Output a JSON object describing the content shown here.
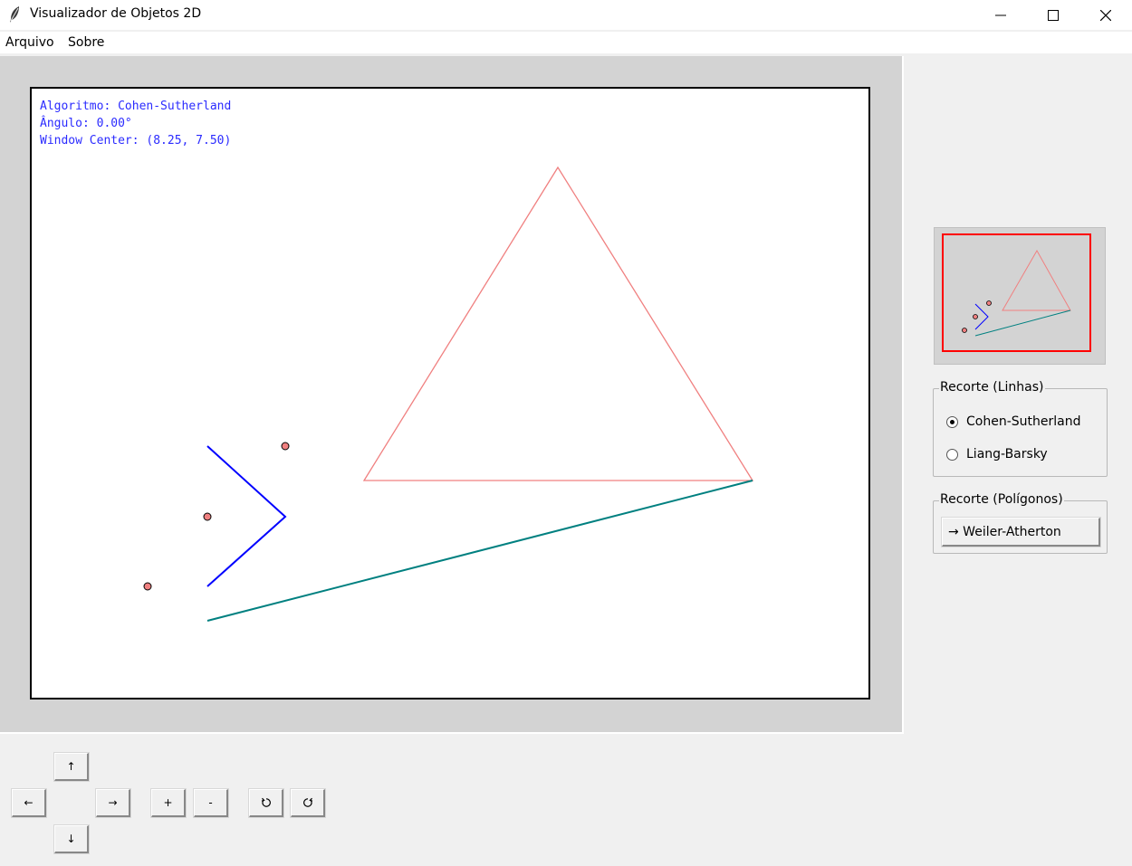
{
  "window": {
    "title": "Visualizador de Objetos 2D",
    "app_icon": "feather-icon",
    "controls": [
      "minimize-icon",
      "maximize-icon",
      "close-icon"
    ]
  },
  "menu": {
    "items": [
      "Arquivo",
      "Sobre"
    ]
  },
  "viewport": {
    "info_lines": [
      "Algoritmo: Cohen-Sutherland",
      "Ângulo: 0.00°",
      "Window Center: (8.25, 7.50)"
    ],
    "colors": {
      "info_text": "#2b2bff",
      "triangle": "#f08080",
      "polyline": "#0000ff",
      "line": "#008080",
      "point_fill": "#f08080",
      "minimap_frame": "#ff0000"
    }
  },
  "clipping_lines": {
    "title": "Recorte (Linhas)",
    "options": [
      "Cohen-Sutherland",
      "Liang-Barsky"
    ],
    "selected": "Cohen-Sutherland"
  },
  "clipping_polygons": {
    "title": "Recorte (Polígonos)",
    "button_label": "→ Weiler-Atherton"
  },
  "controls": {
    "up": "↑",
    "left": "←",
    "right": "→",
    "down": "↓",
    "zoom_in": "+",
    "zoom_out": "-",
    "rotate_left_icon": "rotate-ccw-icon",
    "rotate_right_icon": "rotate-cw-icon"
  }
}
